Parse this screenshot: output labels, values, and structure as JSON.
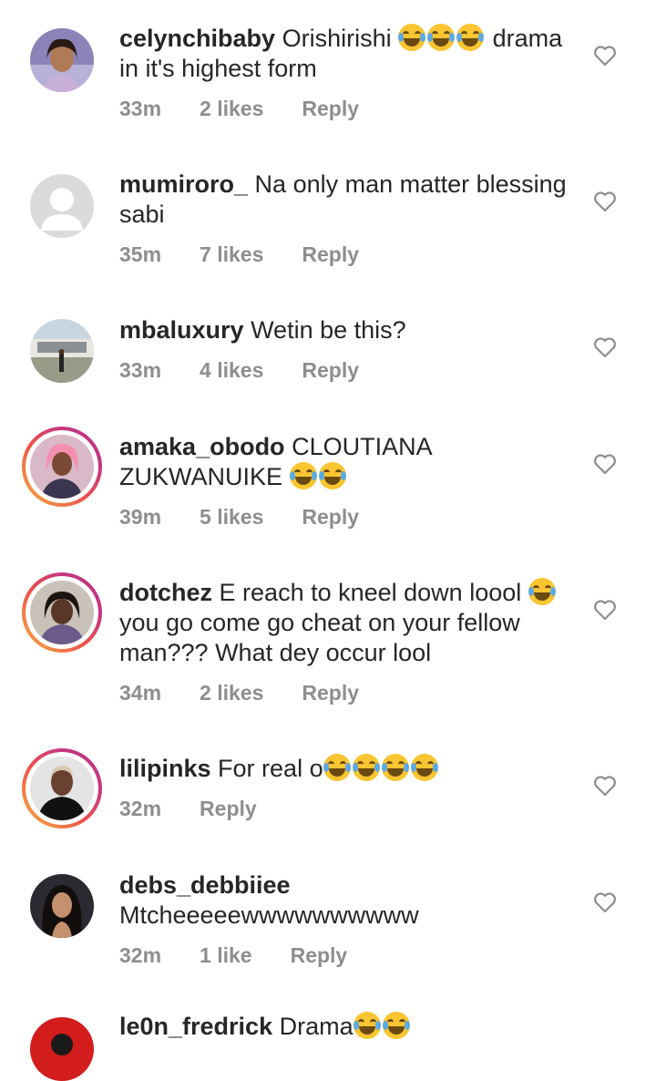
{
  "comments": [
    {
      "username": "celynchibaby",
      "body": "Orishirishi",
      "body_after": "drama in it's highest form",
      "emoji_count": 3,
      "time": "33m",
      "likes": "2 likes",
      "reply": "Reply",
      "ring": false
    },
    {
      "username": "mumiroro_",
      "body": "Na only man matter blessing sabi",
      "time": "35m",
      "likes": "7 likes",
      "reply": "Reply",
      "ring": false
    },
    {
      "username": "mbaluxury",
      "body": "Wetin be this?",
      "time": "33m",
      "likes": "4 likes",
      "reply": "Reply",
      "ring": false
    },
    {
      "username": "amaka_obodo",
      "body": "CLOUTIANA ZUKWANUIKE",
      "emoji_count": 2,
      "time": "39m",
      "likes": "5 likes",
      "reply": "Reply",
      "ring": true
    },
    {
      "username": "dotchez",
      "body": "E reach to kneel down loool",
      "body_after": "you go come go cheat on your fellow man??? What dey occur lool",
      "emoji_count": 1,
      "time": "34m",
      "likes": "2 likes",
      "reply": "Reply",
      "ring": true
    },
    {
      "username": "lilipinks",
      "body": "For real o",
      "emoji_count": 4,
      "time": "32m",
      "likes": "",
      "reply": "Reply",
      "ring": true
    },
    {
      "username": "debs_debbiiee",
      "body": "Mtcheeeeewwwwwwwwww",
      "time": "32m",
      "likes": "1 like",
      "reply": "Reply",
      "ring": false
    },
    {
      "username": "le0n_fredrick",
      "body": "Drama",
      "emoji_count": 2
    }
  ],
  "icons": {
    "like": "heart-outline-icon",
    "emoji": "face-with-tears-of-joy-icon"
  }
}
